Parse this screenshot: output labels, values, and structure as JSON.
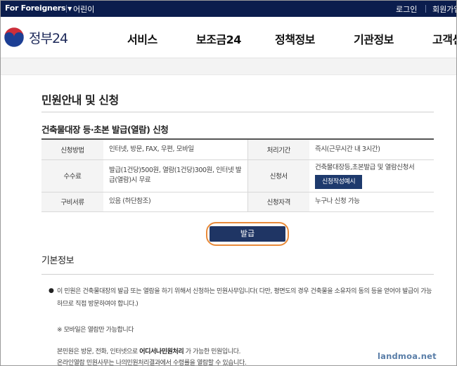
{
  "topbar": {
    "foreigners": "For Foreigners",
    "kids": "어린이",
    "login": "로그인",
    "join": "회원가입"
  },
  "header": {
    "logo_text": "정부24",
    "nav": [
      "서비스",
      "보조금24",
      "정책정보",
      "기관정보",
      "고객센터"
    ]
  },
  "main": {
    "page_title": "민원안내 및 신청",
    "service_name": "건축물대장 등·초본 발급(열람) 신청",
    "info": {
      "method_label": "신청방법",
      "method_value": "인터넷, 방문, FAX, 우편, 모바일",
      "period_label": "처리기간",
      "period_value": "즉시(근무시간 내 3시간)",
      "fee_label": "수수료",
      "fee_value": "발급(1건당)500원, 열람(1건당)300원, 인터넷 발급(열람)시 무료",
      "form_label": "신청서",
      "form_value": "건축물대장등,초본발급 및 열람신청서",
      "form_example_button": "신청작성예시",
      "docs_label": "구비서류",
      "docs_value": "있음 (하단참조)",
      "qual_label": "신청자격",
      "qual_value": "누구나 신청 가능"
    },
    "issue_button": "발급",
    "basic_info_title": "기본정보",
    "bullet_text": "이 민원은 건축물대장의 발급 또는 열람을 하기 위해서 신청하는 민원사무입니다( 다만, 평면도의 경우 건축물을 소유자의 동의 등을 얻어야 발급이 가능하므로 직접 방문하여야 합니다.)",
    "mobile_note": "※ 모바일은 열람만 가능합니다",
    "line1_before": "본민원은 방문, 전화, 인터넷으로 ",
    "line1_bold": "어디서나민원처리",
    "line1_after": " 가 가능한 민원입니다.",
    "line2": "온라인열람 민원사무는 나의민원처리결과에서 수령률을 열람할 수 있습니다."
  },
  "watermark": "landmoa.net",
  "colors": {
    "topbar_bg": "#0b1d4d",
    "button_navy": "#1f3564",
    "highlight_orange": "#e98b3a"
  }
}
